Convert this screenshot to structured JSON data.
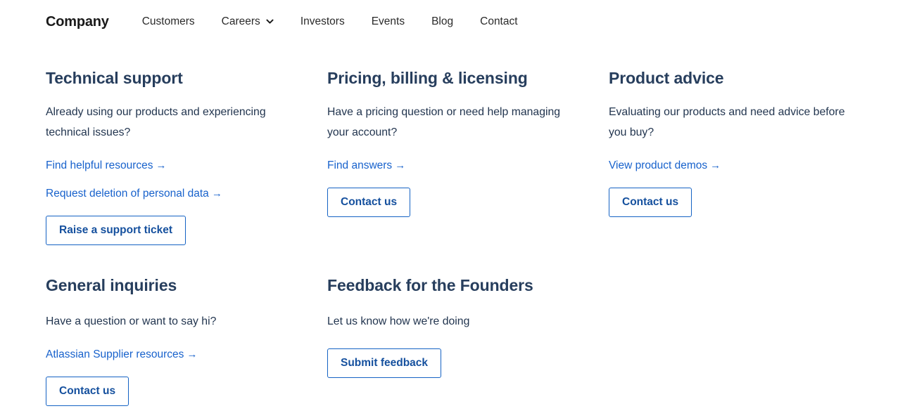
{
  "nav": {
    "brand": "Company",
    "items": [
      {
        "label": "Customers",
        "has_dropdown": false
      },
      {
        "label": "Careers",
        "has_dropdown": true,
        "icon": "chevron-down-icon"
      },
      {
        "label": "Investors",
        "has_dropdown": false
      },
      {
        "label": "Events",
        "has_dropdown": false
      },
      {
        "label": "Blog",
        "has_dropdown": false
      },
      {
        "label": "Contact",
        "has_dropdown": false
      }
    ]
  },
  "colors": {
    "heading": "#273e5d",
    "body_text": "#22354f",
    "link": "#1862cc",
    "button_border": "#1462c4",
    "button_text": "#15509e",
    "brand": "#1a1a1a",
    "background": "#ffffff"
  },
  "arrow_glyph": "→",
  "cards": [
    {
      "title": "Technical support",
      "desc": "Already using our products and experiencing technical issues?",
      "links": [
        {
          "label": "Find helpful resources",
          "arrow": "→"
        },
        {
          "label": "Request deletion of personal data",
          "arrow": "→"
        }
      ],
      "button": "Raise a support ticket"
    },
    {
      "title": "Pricing, billing & licensing",
      "desc": "Have a pricing question or need help managing your account?",
      "links": [
        {
          "label": "Find answers",
          "arrow": "→"
        }
      ],
      "button": "Contact us"
    },
    {
      "title": "Product advice",
      "desc": "Evaluating our products and need advice before you buy?",
      "links": [
        {
          "label": "View product demos",
          "arrow": "→"
        }
      ],
      "button": "Contact us"
    },
    {
      "title": "General inquiries",
      "desc": "Have a question or want to say hi?",
      "links": [
        {
          "label": "Atlassian Supplier resources",
          "arrow": "→"
        }
      ],
      "button": "Contact us"
    },
    {
      "title": "Feedback for the Founders",
      "desc": "Let us know how we're doing",
      "links": [],
      "button": "Submit feedback"
    }
  ]
}
